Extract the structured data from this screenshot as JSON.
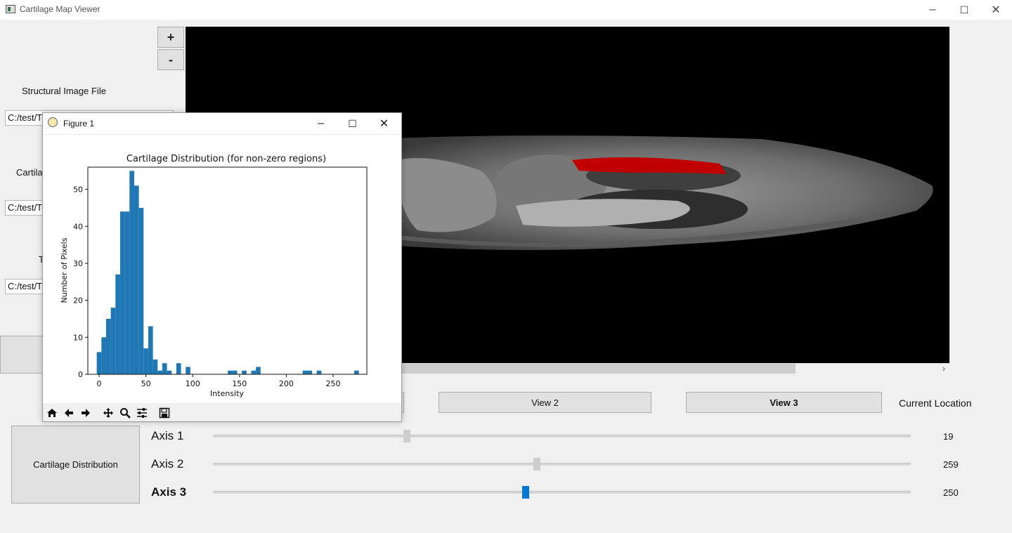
{
  "app": {
    "title": "Cartilage Map Viewer"
  },
  "window_controls": {
    "minimize": "–",
    "maximize": "☐",
    "close": "✕"
  },
  "zoom": {
    "plus": "+",
    "minus": "-"
  },
  "left_panel": {
    "structural_label": "Structural Image File",
    "structural_path": "C:/test/T",
    "cartilage_label_partial": "Cartila",
    "cartilage_path": "C:/test/T",
    "third_label_partial": "T",
    "third_path": "C:/test/T"
  },
  "views": {
    "view2": "View 2",
    "view3": "View 3"
  },
  "current_location_label": "Current Location",
  "cartilage_distribution_button": "Cartilage Distribution",
  "axes": [
    {
      "label": "Axis 1",
      "value": "19",
      "position": 0.2777,
      "active": false
    },
    {
      "label": "Axis 2",
      "value": "259",
      "position": 0.464,
      "active": false
    },
    {
      "label": "Axis 3",
      "value": "250",
      "position": 0.4479,
      "active": true
    }
  ],
  "colors": {
    "accent_blue": "#0078d7",
    "bar_blue": "#1f77b4",
    "cartilage_red": "#c00000"
  },
  "figure": {
    "title": "Figure 1",
    "toolbar_icons": [
      "home-icon",
      "back-icon",
      "forward-icon",
      "pan-icon",
      "zoom-icon",
      "configure-icon",
      "save-icon"
    ]
  },
  "chart_data": {
    "type": "bar",
    "title": "Cartilage Distribution (for non-zero regions)",
    "xlabel": "Intensity",
    "ylabel": "Number of Pixels",
    "xlim": [
      -12,
      286
    ],
    "ylim": [
      0,
      56
    ],
    "xticks": [
      0,
      50,
      100,
      150,
      200,
      250
    ],
    "yticks": [
      0,
      10,
      20,
      30,
      40,
      50
    ],
    "bin_width": 5,
    "bins": [
      {
        "x": 0,
        "y": 6
      },
      {
        "x": 5,
        "y": 10
      },
      {
        "x": 10,
        "y": 15
      },
      {
        "x": 15,
        "y": 18
      },
      {
        "x": 20,
        "y": 27
      },
      {
        "x": 25,
        "y": 44
      },
      {
        "x": 30,
        "y": 44
      },
      {
        "x": 35,
        "y": 55
      },
      {
        "x": 40,
        "y": 51
      },
      {
        "x": 45,
        "y": 45
      },
      {
        "x": 50,
        "y": 7
      },
      {
        "x": 55,
        "y": 13
      },
      {
        "x": 60,
        "y": 4
      },
      {
        "x": 65,
        "y": 1
      },
      {
        "x": 70,
        "y": 3
      },
      {
        "x": 75,
        "y": 1
      },
      {
        "x": 85,
        "y": 3
      },
      {
        "x": 95,
        "y": 2
      },
      {
        "x": 140,
        "y": 1
      },
      {
        "x": 145,
        "y": 1
      },
      {
        "x": 155,
        "y": 1
      },
      {
        "x": 165,
        "y": 1
      },
      {
        "x": 170,
        "y": 2
      },
      {
        "x": 220,
        "y": 1
      },
      {
        "x": 225,
        "y": 1
      },
      {
        "x": 235,
        "y": 1
      },
      {
        "x": 275,
        "y": 1
      }
    ]
  }
}
